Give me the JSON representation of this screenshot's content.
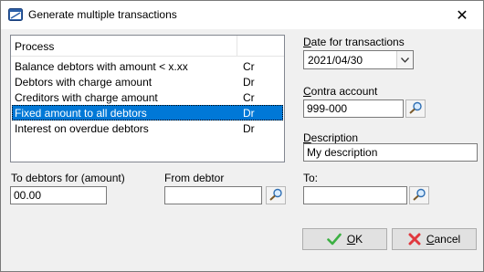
{
  "window": {
    "title": "Generate multiple transactions",
    "close_glyph": "✕",
    "icon": "app-window-icon"
  },
  "process_list": {
    "header": "Process",
    "rows": [
      {
        "name": "Balance debtors with amount < x.xx",
        "side": "Cr",
        "selected": false
      },
      {
        "name": "Debtors with charge amount",
        "side": "Dr",
        "selected": false
      },
      {
        "name": "Creditors with charge amount",
        "side": "Cr",
        "selected": false
      },
      {
        "name": "Fixed amount to all debtors",
        "side": "Dr",
        "selected": true
      },
      {
        "name": "Interest on overdue debtors",
        "side": "Dr",
        "selected": false
      }
    ]
  },
  "date": {
    "label_key": "D",
    "label_rest": "ate for transactions",
    "value": "2021/04/30"
  },
  "contra": {
    "label_key": "C",
    "label_rest": "ontra account",
    "value": "999-000"
  },
  "description": {
    "label_key": "D",
    "label_rest": "escription",
    "value": "My description"
  },
  "to_debtors": {
    "label": "To debtors for (amount)",
    "value": "00.00"
  },
  "from_debtor": {
    "label": "From debtor",
    "value": ""
  },
  "to": {
    "label": "To:",
    "value": ""
  },
  "buttons": {
    "ok_key": "O",
    "ok_rest": "K",
    "cancel_key": "C",
    "cancel_rest": "ancel"
  },
  "colors": {
    "selection": "#0078d7",
    "ok_check": "#3cb043",
    "cancel_x": "#e0383e"
  }
}
